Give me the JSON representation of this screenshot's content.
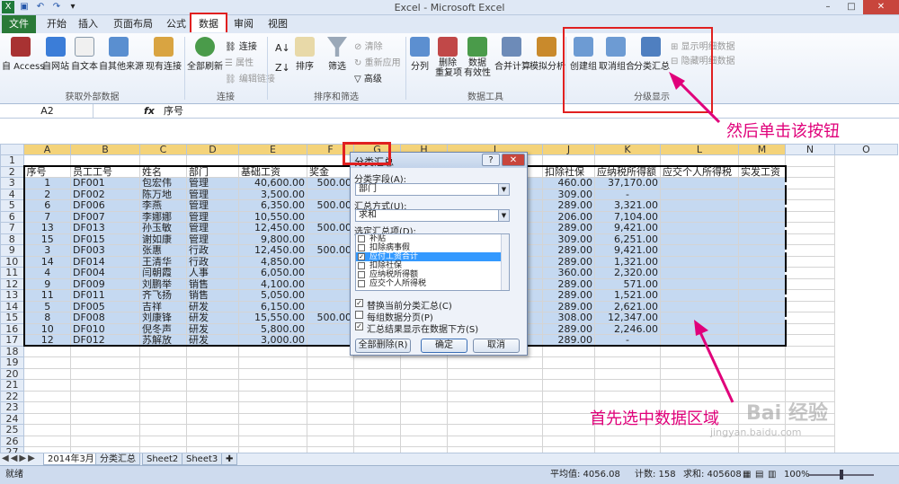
{
  "titlebar": {
    "title": "Excel  -  Microsoft Excel",
    "qat": [
      "excel-logo-icon",
      "save-icon",
      "undo-icon",
      "redo-icon",
      "customize-icon"
    ]
  },
  "tabs": [
    "文件",
    "开始",
    "插入",
    "页面布局",
    "公式",
    "数据",
    "审阅",
    "视图"
  ],
  "active_tab": "数据",
  "ribbon": {
    "external": {
      "buttons": [
        "自 Access",
        "自网站",
        "自文本",
        "自其他来源",
        "现有连接"
      ],
      "label": "获取外部数据"
    },
    "connections": {
      "refresh": "全部刷新",
      "items": [
        "连接",
        "属性",
        "编辑链接"
      ],
      "label": "连接"
    },
    "sort_filter": {
      "sort": "排序",
      "filter": "筛选",
      "items": [
        "清除",
        "重新应用",
        "高级"
      ],
      "label": "排序和筛选"
    },
    "data_tools": {
      "buttons": [
        "分列",
        "删除\n重复项",
        "数据\n有效性",
        "合并计算",
        "模拟分析"
      ],
      "label": "数据工具"
    },
    "outline": {
      "buttons": [
        "创建组",
        "取消组合",
        "分类汇总"
      ],
      "items": [
        "显示明细数据",
        "隐藏明细数据"
      ],
      "label": "分级显示"
    }
  },
  "formula_bar": {
    "name_box": "A2",
    "fx": "fx",
    "content": "序号"
  },
  "columns": [
    "A",
    "B",
    "C",
    "D",
    "E",
    "F",
    "G",
    "H",
    "I",
    "J",
    "K",
    "L",
    "M",
    "N",
    "O"
  ],
  "rows": [
    [
      "1",
      "",
      "",
      "",
      "",
      "",
      "",
      "",
      "",
      "",
      "",
      "",
      "",
      "",
      ""
    ],
    [
      "2",
      "序号",
      "员工工号",
      "姓名",
      "部门",
      "基础工资",
      "奖金",
      "",
      "",
      "",
      "扣除社保",
      "应纳税所得额",
      "应交个人所得税",
      "实发工资",
      ""
    ],
    [
      "3",
      "1",
      "DF001",
      "包宏伟",
      "管理",
      "40,600.00",
      "500.00",
      "",
      "",
      "",
      "460.00",
      "37,170.00",
      "",
      "",
      ""
    ],
    [
      "4",
      "2",
      "DF002",
      "陈万地",
      "管理",
      "3,500.00",
      "",
      "",
      "",
      "",
      "309.00",
      "-",
      "",
      "",
      ""
    ],
    [
      "5",
      "6",
      "DF006",
      "李燕",
      "管理",
      "6,350.00",
      "500.00",
      "",
      "",
      "",
      "289.00",
      "3,321.00",
      "",
      "",
      ""
    ],
    [
      "6",
      "7",
      "DF007",
      "李娜娜",
      "管理",
      "10,550.00",
      "",
      "",
      "",
      "",
      "206.00",
      "7,104.00",
      "",
      "",
      ""
    ],
    [
      "7",
      "13",
      "DF013",
      "孙玉敏",
      "管理",
      "12,450.00",
      "500.00",
      "",
      "",
      "",
      "289.00",
      "9,421.00",
      "",
      "",
      ""
    ],
    [
      "8",
      "15",
      "DF015",
      "谢如康",
      "管理",
      "9,800.00",
      "",
      "",
      "",
      "",
      "309.00",
      "6,251.00",
      "",
      "",
      ""
    ],
    [
      "9",
      "3",
      "DF003",
      "张惠",
      "行政",
      "12,450.00",
      "500.00",
      "",
      "",
      "",
      "289.00",
      "9,421.00",
      "",
      "",
      ""
    ],
    [
      "10",
      "14",
      "DF014",
      "王清华",
      "行政",
      "4,850.00",
      "",
      "",
      "",
      "",
      "289.00",
      "1,321.00",
      "",
      "",
      ""
    ],
    [
      "11",
      "4",
      "DF004",
      "闫朝霞",
      "人事",
      "6,050.00",
      "",
      "",
      "",
      "",
      "360.00",
      "2,320.00",
      "",
      "",
      ""
    ],
    [
      "12",
      "9",
      "DF009",
      "刘鹏举",
      "销售",
      "4,100.00",
      "",
      "",
      "",
      "",
      "289.00",
      "571.00",
      "",
      "",
      ""
    ],
    [
      "13",
      "11",
      "DF011",
      "齐飞扬",
      "销售",
      "5,050.00",
      "",
      "",
      "",
      "",
      "289.00",
      "1,521.00",
      "",
      "",
      ""
    ],
    [
      "14",
      "5",
      "DF005",
      "吉祥",
      "研发",
      "6,150.00",
      "",
      "",
      "",
      "",
      "289.00",
      "2,621.00",
      "",
      "",
      ""
    ],
    [
      "15",
      "8",
      "DF008",
      "刘康锋",
      "研发",
      "15,550.00",
      "500.00",
      "",
      "",
      "",
      "308.00",
      "12,347.00",
      "",
      "",
      ""
    ],
    [
      "16",
      "10",
      "DF010",
      "倪冬声",
      "研发",
      "5,800.00",
      "",
      "",
      "",
      "",
      "289.00",
      "2,246.00",
      "",
      "",
      ""
    ],
    [
      "17",
      "12",
      "DF012",
      "苏解放",
      "研发",
      "3,000.00",
      "",
      "",
      "",
      "",
      "289.00",
      "-",
      "",
      "",
      ""
    ],
    [
      "18",
      "",
      "",
      "",
      "",
      "",
      "",
      "",
      "",
      "",
      "",
      "",
      "",
      "",
      ""
    ],
    [
      "19",
      "",
      "",
      "",
      "",
      "",
      "",
      "",
      "",
      "",
      "",
      "",
      "",
      "",
      ""
    ],
    [
      "20",
      "",
      "",
      "",
      "",
      "",
      "",
      "",
      "",
      "",
      "",
      "",
      "",
      "",
      ""
    ],
    [
      "21",
      "",
      "",
      "",
      "",
      "",
      "",
      "",
      "",
      "",
      "",
      "",
      "",
      "",
      ""
    ],
    [
      "22",
      "",
      "",
      "",
      "",
      "",
      "",
      "",
      "",
      "",
      "",
      "",
      "",
      "",
      ""
    ],
    [
      "23",
      "",
      "",
      "",
      "",
      "",
      "",
      "",
      "",
      "",
      "",
      "",
      "",
      "",
      ""
    ],
    [
      "24",
      "",
      "",
      "",
      "",
      "",
      "",
      "",
      "",
      "",
      "",
      "",
      "",
      "",
      ""
    ],
    [
      "25",
      "",
      "",
      "",
      "",
      "",
      "",
      "",
      "",
      "",
      "",
      "",
      "",
      "",
      ""
    ],
    [
      "26",
      "",
      "",
      "",
      "",
      "",
      "",
      "",
      "",
      "",
      "",
      "",
      "",
      "",
      ""
    ],
    [
      "27",
      "",
      "",
      "",
      "",
      "",
      "",
      "",
      "",
      "",
      "",
      "",
      "",
      "",
      ""
    ]
  ],
  "sheet_tabs": [
    "2014年3月",
    "分类汇总",
    "Sheet2",
    "Sheet3"
  ],
  "active_sheet": "2014年3月",
  "status": {
    "mode": "就绪",
    "average": "平均值: 4056.08",
    "count": "计数: 158",
    "sum": "求和: 405608",
    "zoom": "100%"
  },
  "dialog": {
    "title": "分类汇总",
    "group_label": "分类字段(A):",
    "group_value": "部门",
    "func_label": "汇总方式(U):",
    "func_value": "求和",
    "items_label": "选定汇总项(D):",
    "items": [
      "补贴",
      "扣除病事假",
      "应付工资合计",
      "扣除社保",
      "应纳税所得额",
      "应交个人所得税"
    ],
    "checked_item": "应付工资合计",
    "options": [
      "替换当前分类汇总(C)",
      "每组数据分页(P)",
      "汇总结果显示在数据下方(S)"
    ],
    "options_checked": [
      true,
      false,
      true
    ],
    "buttons": [
      "全部删除(R)",
      "确定",
      "取消"
    ]
  },
  "annotations": {
    "note_button": "然后单击该按钮",
    "note_select": "首先选中数据区域",
    "color": "#e0007a"
  },
  "watermark": {
    "text": "Bai 经验",
    "url": "jingyan.baidu.com"
  }
}
